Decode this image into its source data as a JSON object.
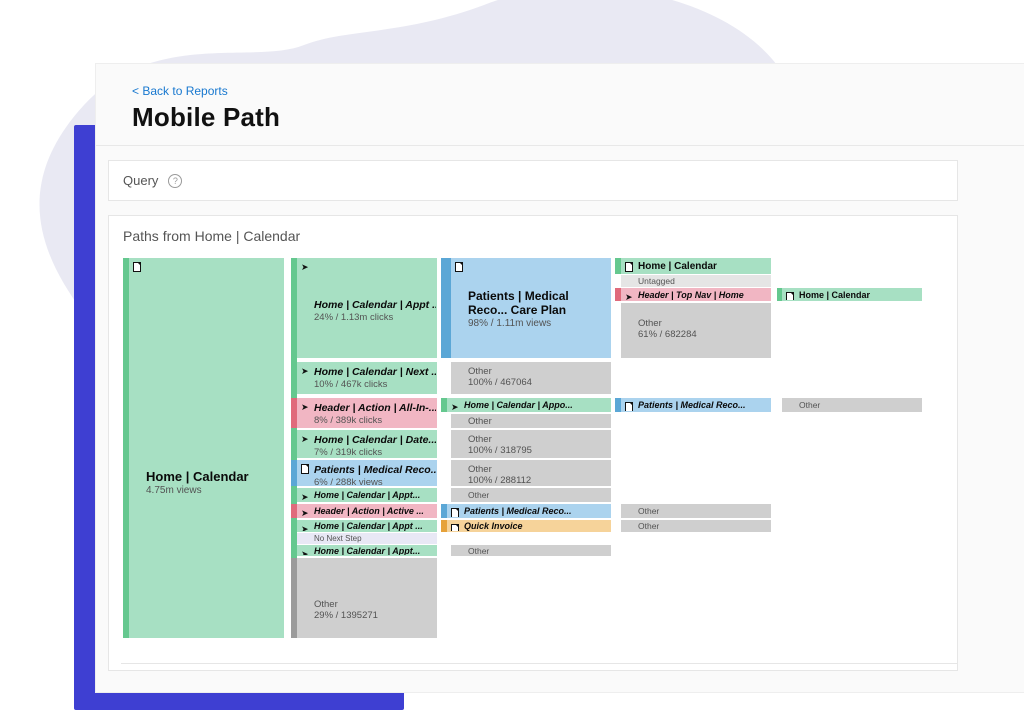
{
  "nav": {
    "back": "< Back to Reports"
  },
  "header": {
    "title": "Mobile Path"
  },
  "query": {
    "label": "Query"
  },
  "paths": {
    "title": "Paths from Home | Calendar"
  },
  "c": {
    "root": {
      "label": "Home | Calendar",
      "sub": "4.75m views"
    },
    "l2_appt": {
      "label": "Home | Calendar | Appt ...",
      "sub": "24% / 1.13m clicks"
    },
    "l2_next": {
      "label": "Home | Calendar | Next ...",
      "sub": "10% / 467k clicks"
    },
    "l2_allin": {
      "label": "Header | Action | All-In-...",
      "sub": "8% / 389k clicks"
    },
    "l2_date": {
      "label": "Home | Calendar | Date...",
      "sub": "7% / 319k clicks"
    },
    "l2_medrec": {
      "label": "Patients | Medical Reco...",
      "sub": "6% / 288k views"
    },
    "l2_appt2": {
      "label": "Home | Calendar | Appt..."
    },
    "l2_active": {
      "label": "Header | Action | Active ..."
    },
    "l2_appt_s1": {
      "label": "Home | Calendar | Appt ..."
    },
    "l2_nonext": {
      "label": "No Next Step"
    },
    "l2_appt_s2": {
      "label": "Home | Calendar | Appt..."
    },
    "l2_other": {
      "label": "Other",
      "sub": "29% / 1395271"
    },
    "l3_careplan": {
      "label": "Patients | Medical Reco... Care Plan",
      "sub": "98% / 1.11m views"
    },
    "l3_other1": {
      "label": "Other",
      "sub": "100% / 467064"
    },
    "l3_appo": {
      "label": "Home | Calendar | Appo..."
    },
    "l3_other2": {
      "label": "Other"
    },
    "l3_other3": {
      "label": "Other",
      "sub": "100% / 318795"
    },
    "l3_other4": {
      "label": "Other",
      "sub": "100% / 288112"
    },
    "l3_other5": {
      "label": "Other"
    },
    "l3_medrec": {
      "label": "Patients | Medical Reco..."
    },
    "l3_qinv": {
      "label": "Quick Invoice"
    },
    "l3_other6": {
      "label": "Other"
    },
    "l4_homecal": {
      "label": "Home | Calendar"
    },
    "l4_untag": {
      "label": "Untagged"
    },
    "l4_topnav": {
      "label": "Header | Top Nav | Home"
    },
    "l4_other": {
      "label": "Other",
      "sub": "61% / 682284"
    },
    "l4_medrec": {
      "label": "Patients | Medical Reco..."
    },
    "l4_other2": {
      "label": "Other"
    },
    "l4_other3": {
      "label": "Other"
    },
    "l5_homecal": {
      "label": "Home | Calendar"
    },
    "l5_other": {
      "label": "Other"
    }
  }
}
